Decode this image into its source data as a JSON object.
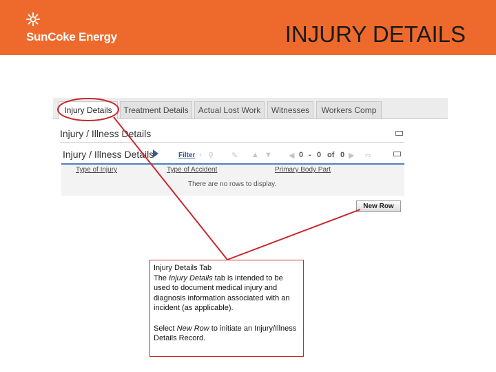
{
  "header": {
    "logo_text": "SunCoke Energy",
    "slide_title": "INJURY DETAILS"
  },
  "tabs": [
    {
      "label": "Injury Details",
      "active": true
    },
    {
      "label": "Treatment Details",
      "active": false
    },
    {
      "label": "Actual Lost Work",
      "active": false
    },
    {
      "label": "Witnesses",
      "active": false
    },
    {
      "label": "Workers Comp",
      "active": false
    }
  ],
  "section": {
    "title": "Injury / Illness Details"
  },
  "panel": {
    "title": "Injury / Illness Details",
    "filter_label": "Filter",
    "pager": {
      "current": "0",
      "separator": "-",
      "end": "0",
      "of_label": "of",
      "total": "0"
    },
    "columns": [
      "Type of Injury",
      "Type of Accident",
      "Primary Body Part"
    ],
    "empty_message": "There are no rows to display.",
    "new_row_label": "New Row"
  },
  "callout": {
    "heading": "Injury Details Tab",
    "body_pre": "The ",
    "body_em": "Injury Details",
    "body_post": " tab is intended to be used to document medical injury and diagnosis information associated with an incident (as applicable).",
    "action_pre": "Select ",
    "action_em": "New Row",
    "action_post": " to initiate an Injury/Illness Details Record."
  },
  "colors": {
    "banner": "#ee6a2c",
    "callout_border": "#c8282c",
    "pointer_line": "#c8282c",
    "accent_blue": "#4f7fbf"
  },
  "icons": [
    "sun-icon",
    "expand-arrow-icon",
    "filter-arrow-icon",
    "search-icon",
    "edit-icon",
    "move-up-icon",
    "move-down-icon",
    "prev-page-icon",
    "next-page-icon",
    "export-icon",
    "collapse-icon"
  ]
}
